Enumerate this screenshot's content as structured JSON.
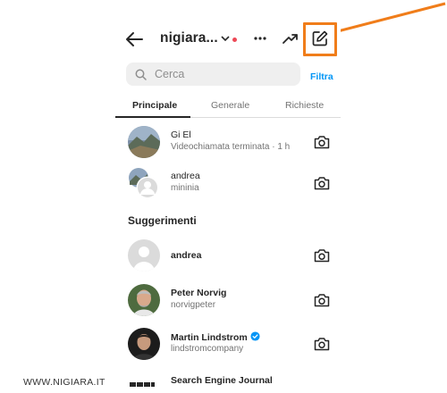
{
  "header": {
    "username": "nigiara...",
    "more_icon": "more-horizontal-icon",
    "trend_icon": "trending-icon",
    "compose_icon": "new-message-icon"
  },
  "search": {
    "placeholder": "Cerca",
    "filter_label": "Filtra"
  },
  "tabs": [
    {
      "label": "Principale",
      "active": true
    },
    {
      "label": "Generale",
      "active": false
    },
    {
      "label": "Richieste",
      "active": false
    }
  ],
  "conversations": [
    {
      "name": "Gi El",
      "sub": "Videochiamata terminata · 1 h"
    },
    {
      "name": "andrea",
      "sub": "mininia"
    }
  ],
  "suggestions_title": "Suggerimenti",
  "suggestions": [
    {
      "name": "andrea",
      "sub": ""
    },
    {
      "name": "Peter Norvig",
      "sub": "norvigpeter"
    },
    {
      "name": "Martin Lindstrom",
      "sub": "lindstromcompany",
      "verified": true
    },
    {
      "name": "Search Engine Journal",
      "sub": ""
    }
  ],
  "watermark": "WWW.NIGIARA.IT",
  "colors": {
    "accent_blue": "#0095f6",
    "notification_red": "#ed4956",
    "highlight_orange": "#f07d1a"
  }
}
